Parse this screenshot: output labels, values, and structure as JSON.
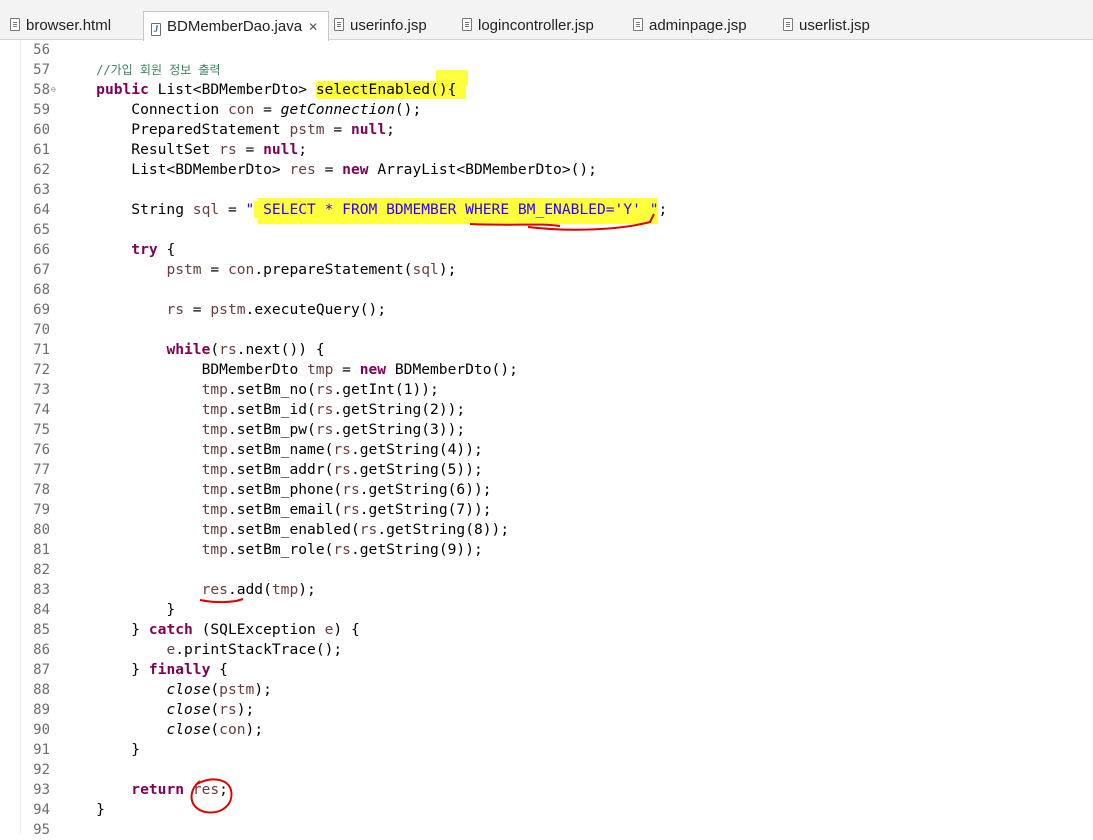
{
  "tabs": [
    {
      "label": "browser.html",
      "icon": "html-file-icon",
      "active": false
    },
    {
      "label": "BDMemberDao.java",
      "icon": "java-file-icon",
      "active": true,
      "close": "✕"
    },
    {
      "label": "userinfo.jsp",
      "icon": "jsp-file-icon",
      "active": false
    },
    {
      "label": "logincontroller.jsp",
      "icon": "jsp-file-icon",
      "active": false
    },
    {
      "label": "adminpage.jsp",
      "icon": "jsp-file-icon",
      "active": false
    },
    {
      "label": "userlist.jsp",
      "icon": "jsp-file-icon",
      "active": false
    }
  ],
  "colors": {
    "keyword": "#7f0055",
    "string": "#2a00ff",
    "comment": "#3f7f5f",
    "variable": "#6a3e3e",
    "highlight": "#ffff3b",
    "annotation": "#e00000"
  },
  "lines": [
    {
      "no": "56",
      "segs": []
    },
    {
      "no": "57",
      "segs": [
        {
          "t": "    "
        },
        {
          "t": "//가입 회원 정보 출력",
          "c": "cm"
        }
      ]
    },
    {
      "no": "58",
      "fold": "⊖",
      "segs": [
        {
          "t": "    "
        },
        {
          "t": "public",
          "c": "kw"
        },
        {
          "t": " List<BDMemberDto> "
        },
        {
          "t": "selectEnabled(){",
          "c": "hl"
        }
      ]
    },
    {
      "no": "59",
      "segs": [
        {
          "t": "        Connection "
        },
        {
          "t": "con",
          "c": "var"
        },
        {
          "t": " = "
        },
        {
          "t": "getConnection",
          "c": "it"
        },
        {
          "t": "();"
        }
      ]
    },
    {
      "no": "60",
      "segs": [
        {
          "t": "        PreparedStatement "
        },
        {
          "t": "pstm",
          "c": "var"
        },
        {
          "t": " = "
        },
        {
          "t": "null",
          "c": "kw"
        },
        {
          "t": ";"
        }
      ]
    },
    {
      "no": "61",
      "segs": [
        {
          "t": "        ResultSet "
        },
        {
          "t": "rs",
          "c": "var"
        },
        {
          "t": " = "
        },
        {
          "t": "null",
          "c": "kw"
        },
        {
          "t": ";"
        }
      ]
    },
    {
      "no": "62",
      "segs": [
        {
          "t": "        List<BDMemberDto> "
        },
        {
          "t": "res",
          "c": "var"
        },
        {
          "t": " = "
        },
        {
          "t": "new",
          "c": "kw"
        },
        {
          "t": " ArrayList<BDMemberDto>();"
        }
      ]
    },
    {
      "no": "63",
      "segs": []
    },
    {
      "no": "64",
      "segs": [
        {
          "t": "        String "
        },
        {
          "t": "sql",
          "c": "var"
        },
        {
          "t": " = "
        },
        {
          "t": "\"",
          "c": "str"
        },
        {
          "t": " SELECT * FROM BDMEMBER WHERE BM_ENABLED='Y'",
          "c": "str hl"
        },
        {
          "t": " \"",
          "c": "str"
        },
        {
          "t": ";"
        }
      ]
    },
    {
      "no": "65",
      "segs": []
    },
    {
      "no": "66",
      "segs": [
        {
          "t": "        "
        },
        {
          "t": "try",
          "c": "kw"
        },
        {
          "t": " {"
        }
      ]
    },
    {
      "no": "67",
      "segs": [
        {
          "t": "            "
        },
        {
          "t": "pstm",
          "c": "var"
        },
        {
          "t": " = "
        },
        {
          "t": "con",
          "c": "var"
        },
        {
          "t": ".prepareStatement("
        },
        {
          "t": "sql",
          "c": "var"
        },
        {
          "t": ");"
        }
      ]
    },
    {
      "no": "68",
      "segs": []
    },
    {
      "no": "69",
      "segs": [
        {
          "t": "            "
        },
        {
          "t": "rs",
          "c": "var"
        },
        {
          "t": " = "
        },
        {
          "t": "pstm",
          "c": "var"
        },
        {
          "t": ".executeQuery();"
        }
      ]
    },
    {
      "no": "70",
      "segs": []
    },
    {
      "no": "71",
      "segs": [
        {
          "t": "            "
        },
        {
          "t": "while",
          "c": "kw"
        },
        {
          "t": "("
        },
        {
          "t": "rs",
          "c": "var"
        },
        {
          "t": ".next()) {"
        }
      ]
    },
    {
      "no": "72",
      "segs": [
        {
          "t": "                BDMemberDto "
        },
        {
          "t": "tmp",
          "c": "var"
        },
        {
          "t": " = "
        },
        {
          "t": "new",
          "c": "kw"
        },
        {
          "t": " BDMemberDto();"
        }
      ]
    },
    {
      "no": "73",
      "segs": [
        {
          "t": "                "
        },
        {
          "t": "tmp",
          "c": "var"
        },
        {
          "t": ".setBm_no("
        },
        {
          "t": "rs",
          "c": "var"
        },
        {
          "t": ".getInt(1));"
        }
      ]
    },
    {
      "no": "74",
      "segs": [
        {
          "t": "                "
        },
        {
          "t": "tmp",
          "c": "var"
        },
        {
          "t": ".setBm_id("
        },
        {
          "t": "rs",
          "c": "var"
        },
        {
          "t": ".getString(2));"
        }
      ]
    },
    {
      "no": "75",
      "segs": [
        {
          "t": "                "
        },
        {
          "t": "tmp",
          "c": "var"
        },
        {
          "t": ".setBm_pw("
        },
        {
          "t": "rs",
          "c": "var"
        },
        {
          "t": ".getString(3));"
        }
      ]
    },
    {
      "no": "76",
      "segs": [
        {
          "t": "                "
        },
        {
          "t": "tmp",
          "c": "var"
        },
        {
          "t": ".setBm_name("
        },
        {
          "t": "rs",
          "c": "var"
        },
        {
          "t": ".getString(4));"
        }
      ]
    },
    {
      "no": "77",
      "segs": [
        {
          "t": "                "
        },
        {
          "t": "tmp",
          "c": "var"
        },
        {
          "t": ".setBm_addr("
        },
        {
          "t": "rs",
          "c": "var"
        },
        {
          "t": ".getString(5));"
        }
      ]
    },
    {
      "no": "78",
      "segs": [
        {
          "t": "                "
        },
        {
          "t": "tmp",
          "c": "var"
        },
        {
          "t": ".setBm_phone("
        },
        {
          "t": "rs",
          "c": "var"
        },
        {
          "t": ".getString(6));"
        }
      ]
    },
    {
      "no": "79",
      "segs": [
        {
          "t": "                "
        },
        {
          "t": "tmp",
          "c": "var"
        },
        {
          "t": ".setBm_email("
        },
        {
          "t": "rs",
          "c": "var"
        },
        {
          "t": ".getString(7));"
        }
      ]
    },
    {
      "no": "80",
      "segs": [
        {
          "t": "                "
        },
        {
          "t": "tmp",
          "c": "var"
        },
        {
          "t": ".setBm_enabled("
        },
        {
          "t": "rs",
          "c": "var"
        },
        {
          "t": ".getString(8));"
        }
      ]
    },
    {
      "no": "81",
      "segs": [
        {
          "t": "                "
        },
        {
          "t": "tmp",
          "c": "var"
        },
        {
          "t": ".setBm_role("
        },
        {
          "t": "rs",
          "c": "var"
        },
        {
          "t": ".getString(9));"
        }
      ]
    },
    {
      "no": "82",
      "segs": []
    },
    {
      "no": "83",
      "segs": [
        {
          "t": "                "
        },
        {
          "t": "res",
          "c": "var"
        },
        {
          "t": ".add("
        },
        {
          "t": "tmp",
          "c": "var"
        },
        {
          "t": ");"
        }
      ]
    },
    {
      "no": "84",
      "segs": [
        {
          "t": "            }"
        }
      ]
    },
    {
      "no": "85",
      "segs": [
        {
          "t": "        } "
        },
        {
          "t": "catch",
          "c": "kw"
        },
        {
          "t": " (SQLException "
        },
        {
          "t": "e",
          "c": "var"
        },
        {
          "t": ") {"
        }
      ]
    },
    {
      "no": "86",
      "segs": [
        {
          "t": "            "
        },
        {
          "t": "e",
          "c": "var"
        },
        {
          "t": ".printStackTrace();"
        }
      ]
    },
    {
      "no": "87",
      "segs": [
        {
          "t": "        } "
        },
        {
          "t": "finally",
          "c": "kw"
        },
        {
          "t": " {"
        }
      ]
    },
    {
      "no": "88",
      "segs": [
        {
          "t": "            "
        },
        {
          "t": "close",
          "c": "it"
        },
        {
          "t": "("
        },
        {
          "t": "pstm",
          "c": "var"
        },
        {
          "t": ");"
        }
      ]
    },
    {
      "no": "89",
      "segs": [
        {
          "t": "            "
        },
        {
          "t": "close",
          "c": "it"
        },
        {
          "t": "("
        },
        {
          "t": "rs",
          "c": "var"
        },
        {
          "t": ");"
        }
      ]
    },
    {
      "no": "90",
      "segs": [
        {
          "t": "            "
        },
        {
          "t": "close",
          "c": "it"
        },
        {
          "t": "("
        },
        {
          "t": "con",
          "c": "var"
        },
        {
          "t": ");"
        }
      ]
    },
    {
      "no": "91",
      "segs": [
        {
          "t": "        }"
        }
      ]
    },
    {
      "no": "92",
      "segs": []
    },
    {
      "no": "93",
      "segs": [
        {
          "t": "        "
        },
        {
          "t": "return",
          "c": "kw"
        },
        {
          "t": " "
        },
        {
          "t": "res",
          "c": "var"
        },
        {
          "t": ";"
        }
      ]
    },
    {
      "no": "94",
      "segs": [
        {
          "t": "    }"
        }
      ]
    },
    {
      "no": "95",
      "segs": []
    }
  ]
}
